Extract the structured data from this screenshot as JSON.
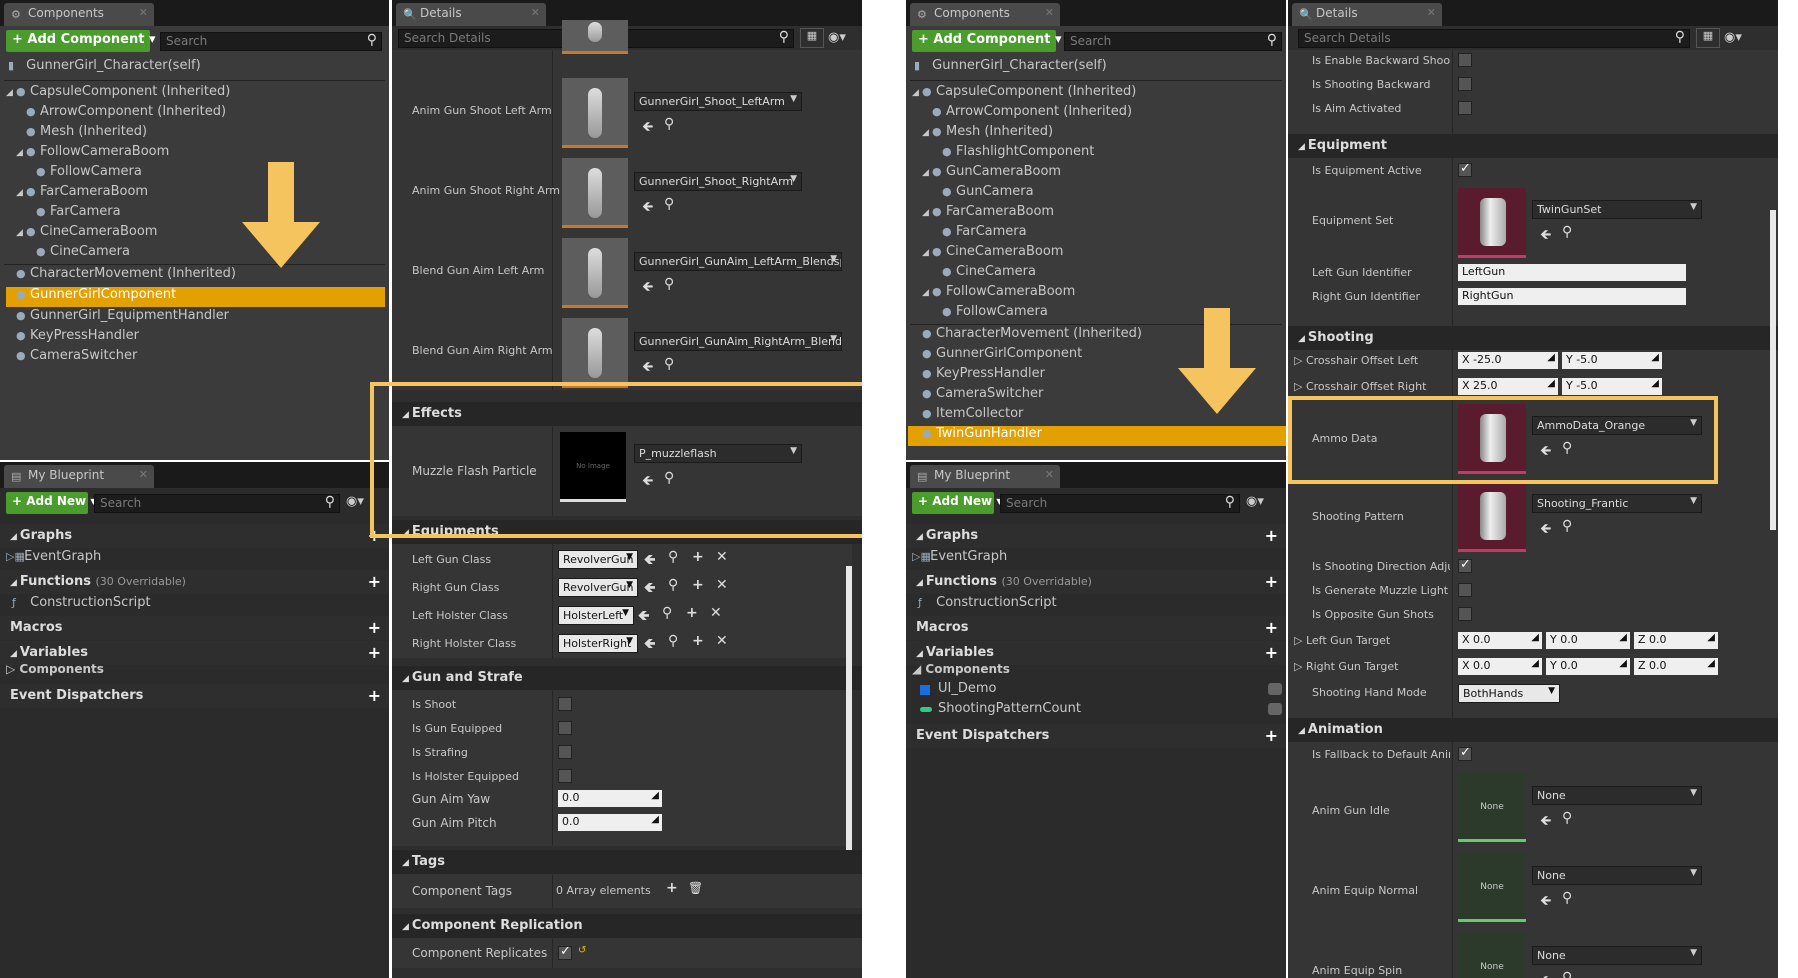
{
  "colors": {
    "accent": "#e2a100",
    "green": "#4a9c2c",
    "highlight": "#f5c45e"
  },
  "left_components": {
    "tab": "Components",
    "add_button": "+ Add Component ▾",
    "search": "Search",
    "self": "GunnerGirl_Character(self)",
    "tree": [
      "CapsuleComponent (Inherited)",
      "ArrowComponent (Inherited)",
      "Mesh (Inherited)",
      "FollowCameraBoom",
      "FollowCamera",
      "FarCameraBoom",
      "FarCamera",
      "CineCameraBoom",
      "CineCamera",
      "CharacterMovement (Inherited)",
      "GunnerGirlComponent",
      "GunnerGirl_EquipmentHandler",
      "KeyPressHandler",
      "CameraSwitcher"
    ]
  },
  "left_blueprint": {
    "tab": "My Blueprint",
    "add_new": "+ Add New ▾",
    "search": "Search",
    "graphs": "Graphs",
    "event_graph": "EventGraph",
    "functions": "Functions",
    "functions_count": "(30 Overridable)",
    "construction": "ConstructionScript",
    "macros": "Macros",
    "variables": "Variables",
    "components": "Components",
    "dispatchers": "Event Dispatchers"
  },
  "left_details": {
    "tab": "Details",
    "search": "Search Details",
    "anims": [
      {
        "label": "Anim Gun Shoot Left Arm",
        "asset": "GunnerGirl_Shoot_LeftArm"
      },
      {
        "label": "Anim Gun Shoot Right Arm",
        "asset": "GunnerGirl_Shoot_RightArm"
      },
      {
        "label": "Blend Gun Aim Left Arm",
        "asset": "GunnerGirl_GunAim_LeftArm_Blendspace"
      },
      {
        "label": "Blend Gun Aim Right Arm",
        "asset": "GunnerGirl_GunAim_RightArm_Blendspace"
      }
    ],
    "effects": "Effects",
    "muzzle_label": "Muzzle Flash Particle",
    "muzzle_asset": "P_muzzleflash",
    "no_image": "No Image",
    "equipments": "Equipments",
    "equip_rows": [
      {
        "label": "Left Gun Class",
        "value": "RevolverGun"
      },
      {
        "label": "Right Gun Class",
        "value": "RevolverGun"
      },
      {
        "label": "Left Holster Class",
        "value": "HolsterLeft"
      },
      {
        "label": "Right Holster Class",
        "value": "HolsterRight"
      }
    ],
    "gun_strafe": "Gun and Strafe",
    "bools": [
      "Is Shoot",
      "Is Gun Equipped",
      "Is Strafing",
      "Is Holster Equipped"
    ],
    "aim_yaw": "Gun Aim Yaw",
    "aim_yaw_val": "0.0",
    "aim_pitch": "Gun Aim Pitch",
    "aim_pitch_val": "0.0",
    "tags": "Tags",
    "comp_tags": "Component Tags",
    "array_elems": "0 Array elements",
    "replication": "Component Replication",
    "replicates": "Component Replicates"
  },
  "right_components": {
    "tab": "Components",
    "add_button": "+ Add Component ▾",
    "search": "Search",
    "self": "GunnerGirl_Character(self)",
    "tree": [
      "CapsuleComponent (Inherited)",
      "ArrowComponent (Inherited)",
      "Mesh (Inherited)",
      "FlashlightComponent",
      "GunCameraBoom",
      "GunCamera",
      "FarCameraBoom",
      "FarCamera",
      "CineCameraBoom",
      "CineCamera",
      "FollowCameraBoom",
      "FollowCamera",
      "CharacterMovement (Inherited)",
      "GunnerGirlComponent",
      "KeyPressHandler",
      "CameraSwitcher",
      "ItemCollector",
      "TwinGunHandler"
    ]
  },
  "right_blueprint": {
    "tab": "My Blueprint",
    "add_new": "+ Add New ▾",
    "search": "Search",
    "graphs": "Graphs",
    "event_graph": "EventGraph",
    "functions": "Functions",
    "functions_count": "(30 Overridable)",
    "construction": "ConstructionScript",
    "macros": "Macros",
    "variables": "Variables",
    "components": "Components",
    "vars": [
      "UI_Demo",
      "ShootingPatternCount"
    ],
    "dispatchers": "Event Dispatchers"
  },
  "right_details": {
    "tab": "Details",
    "search": "Search Details",
    "top_bools": [
      "Is Enable Backward Shooting",
      "Is Shooting Backward",
      "Is Aim Activated"
    ],
    "equipment": "Equipment",
    "equip_active": "Is Equipment Active",
    "equip_set": "Equipment Set",
    "equip_set_val": "TwinGunSet",
    "left_gun_id": "Left Gun Identifier",
    "left_gun_id_val": "LeftGun",
    "right_gun_id": "Right Gun Identifier",
    "right_gun_id_val": "RightGun",
    "shooting": "Shooting",
    "cross_left": "Crosshair Offset Left",
    "cross_left_x": "X -25.0",
    "cross_left_y": "Y -5.0",
    "cross_right": "Crosshair Offset Right",
    "cross_right_x": "X 25.0",
    "cross_right_y": "Y -5.0",
    "ammo": "Ammo Data",
    "ammo_val": "AmmoData_Orange",
    "pattern": "Shooting Pattern",
    "pattern_val": "Shooting_Frantic",
    "dir_adjust": "Is Shooting Direction Adjusted",
    "muzzle_light": "Is Generate Muzzle Light",
    "opposite": "Is Opposite Gun Shots",
    "left_target": "Left Gun Target",
    "right_target": "Right Gun Target",
    "target_x": "X 0.0",
    "target_y": "Y 0.0",
    "target_z": "Z 0.0",
    "hand_mode": "Shooting Hand Mode",
    "hand_mode_val": "BothHands",
    "animation": "Animation",
    "fallback": "Is Fallback to Default Animation",
    "anims": [
      {
        "label": "Anim Gun Idle",
        "val": "None"
      },
      {
        "label": "Anim Equip Normal",
        "val": "None"
      },
      {
        "label": "Anim Equip Spin",
        "val": "None"
      }
    ],
    "none_thumb": "None"
  }
}
